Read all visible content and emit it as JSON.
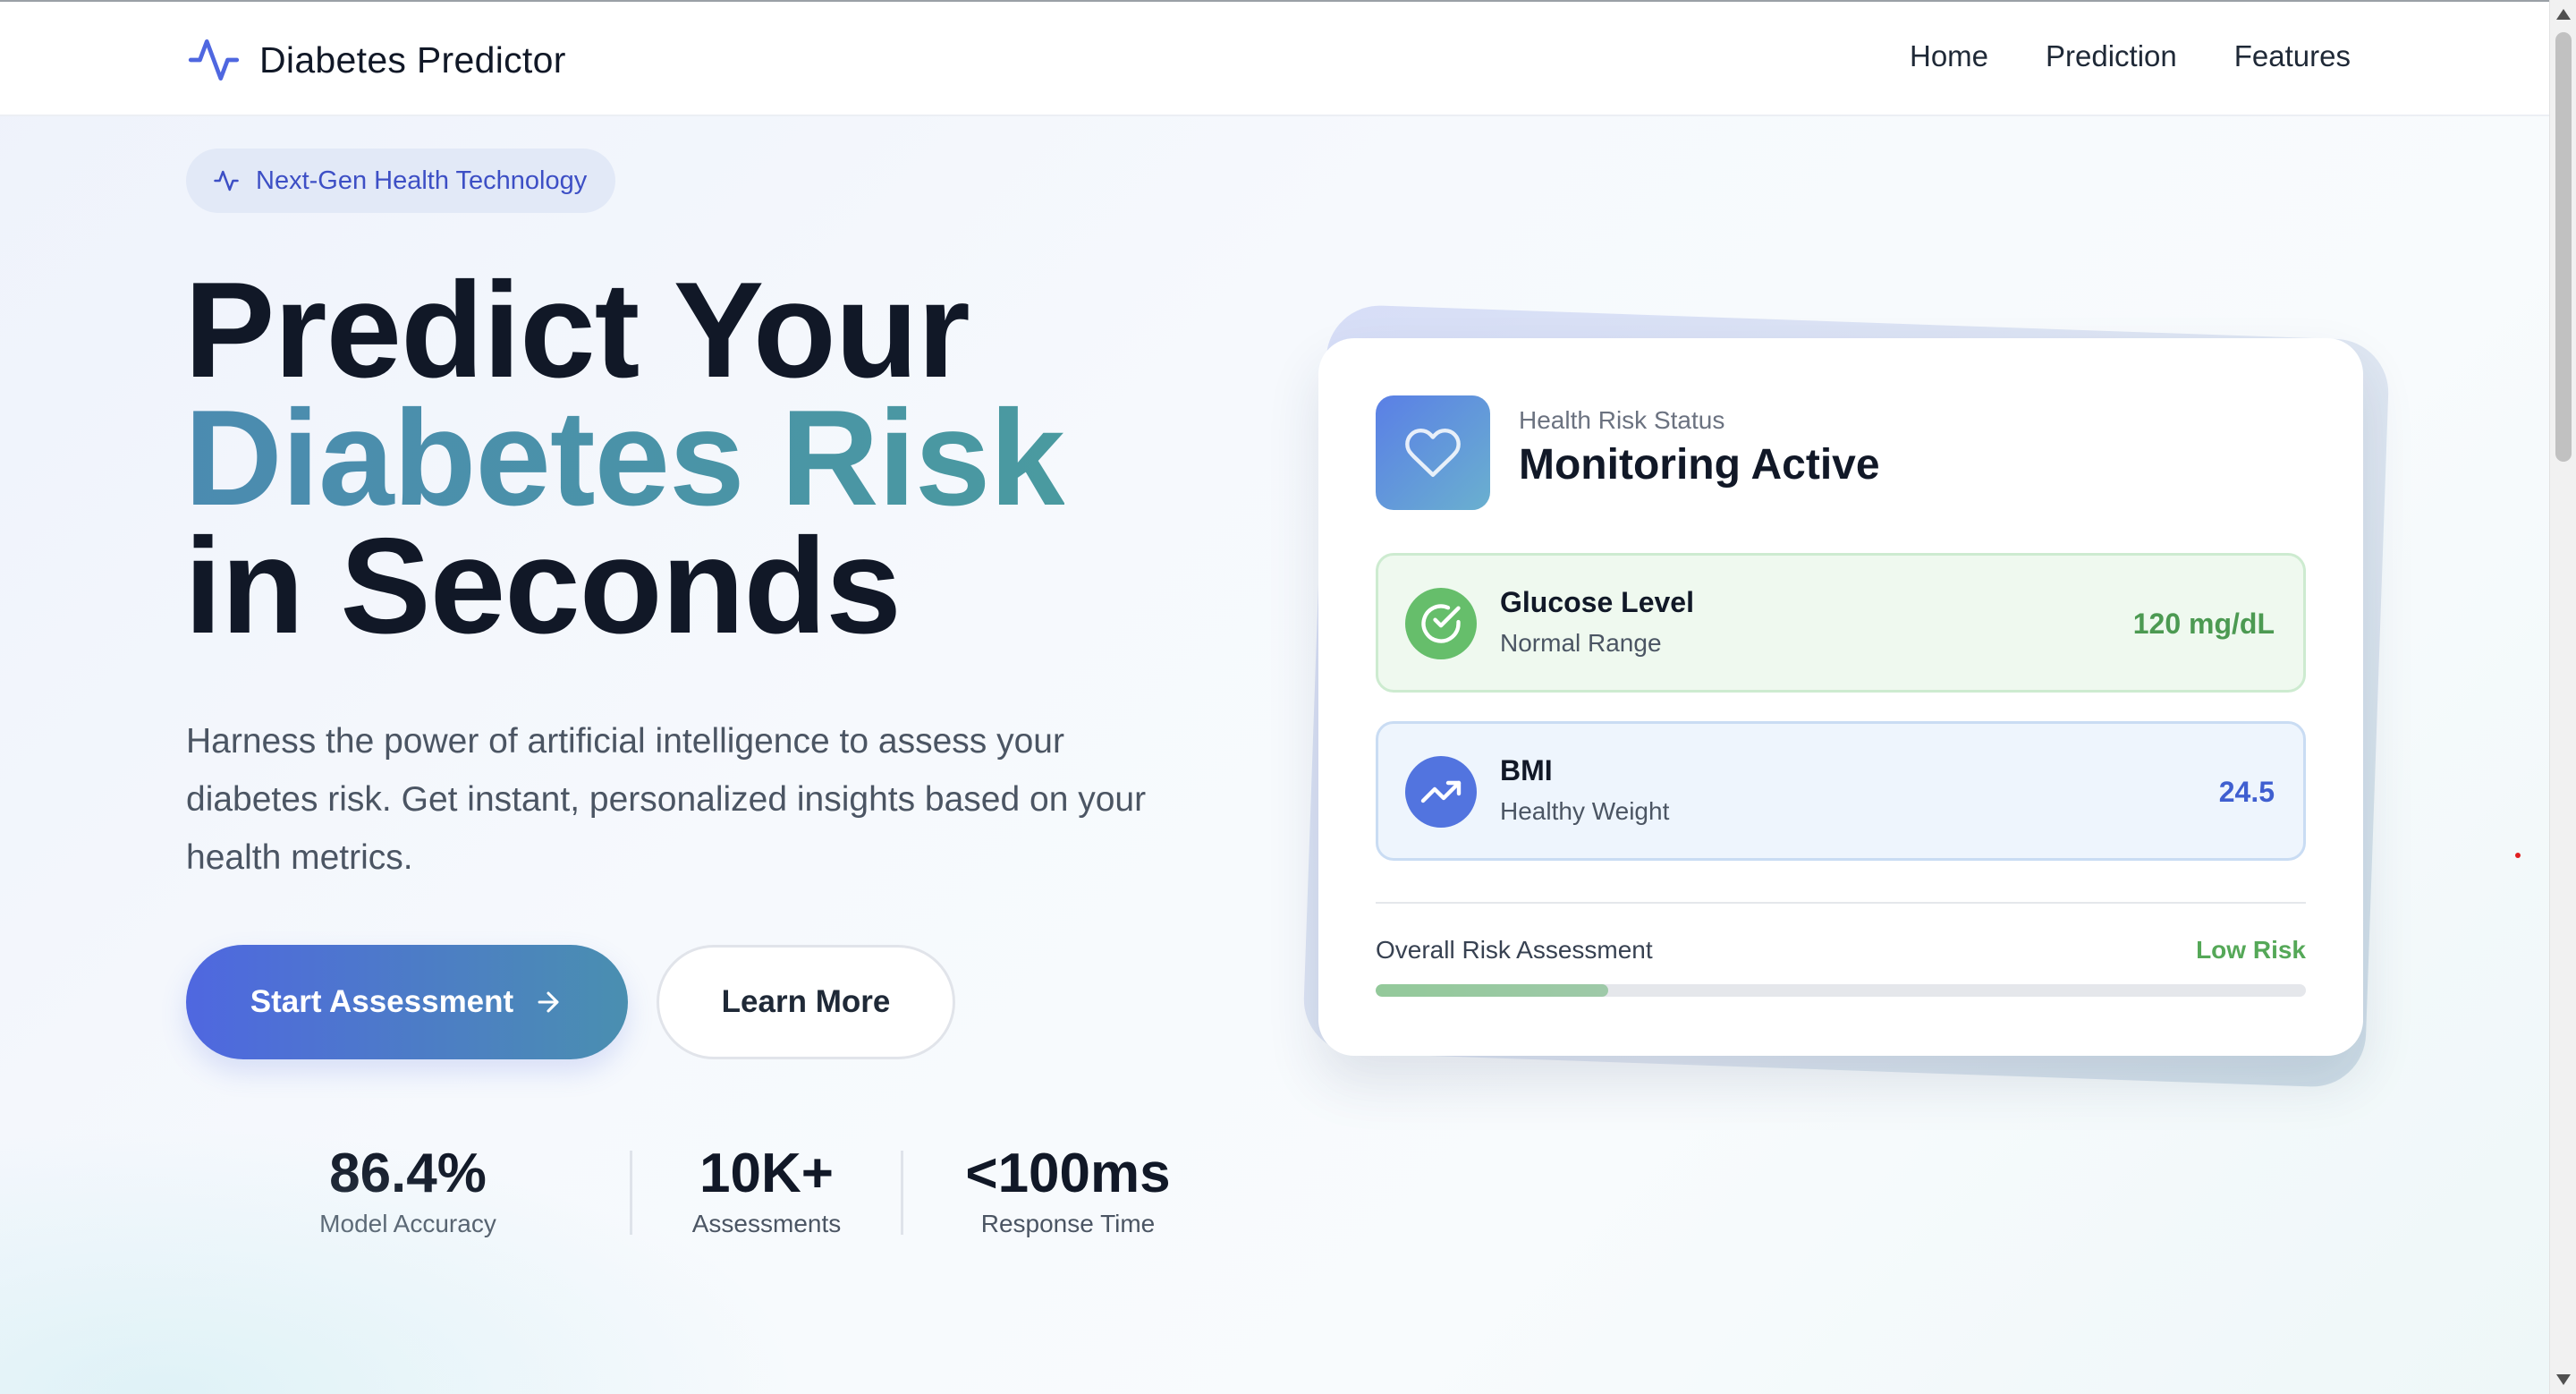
{
  "nav": {
    "brand": "Diabetes Predictor",
    "brand_icon": "pulse-icon",
    "links": [
      "Home",
      "Prediction",
      "Features"
    ]
  },
  "hero": {
    "badge": "Next-Gen Health Technology",
    "title_line1": "Predict Your",
    "title_line2": "Diabetes Risk",
    "title_line3": "in Seconds",
    "description": "Harness the power of artificial intelligence to assess your diabetes risk. Get instant, personalized insights based on your health metrics.",
    "primary_button": "Start Assessment",
    "primary_button_icon": "arrow-right-icon",
    "secondary_button": "Learn More"
  },
  "stats": [
    {
      "value": "86.4%",
      "label": "Model Accuracy"
    },
    {
      "value": "10K+",
      "label": "Assessments"
    },
    {
      "value": "<100ms",
      "label": "Response Time"
    }
  ],
  "card": {
    "icon": "heart-icon",
    "subtitle": "Health Risk Status",
    "title": "Monitoring Active",
    "metrics": [
      {
        "name": "Glucose Level",
        "note": "Normal Range",
        "value": "120 mg/dL",
        "icon": "check-circle-icon",
        "color": "#66be6b"
      },
      {
        "name": "BMI",
        "note": "Healthy Weight",
        "value": "24.5",
        "icon": "trending-up-icon",
        "color": "#5274df"
      }
    ],
    "risk_label": "Overall Risk Assessment",
    "risk_value": "Low Risk",
    "risk_progress": 0.25
  },
  "colors": {
    "accent": "#4f67e0",
    "teal": "#4a9aa0",
    "success": "#55a858"
  }
}
